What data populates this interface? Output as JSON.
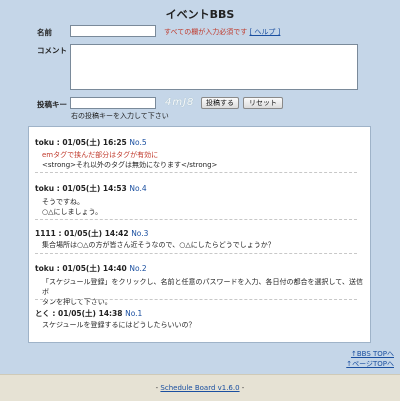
{
  "page": {
    "title": "イベントBBS"
  },
  "form": {
    "name_label": "名前",
    "comment_label": "コメント",
    "key_label": "投稿キー",
    "required_note": "すべての欄が入力必須です",
    "help_link": "[ ヘルプ ]",
    "captcha_text": "4mJ8",
    "submit_label": "投稿する",
    "reset_label": "リセット",
    "key_hint": "右の投稿キーを入力して下さい"
  },
  "posts": [
    {
      "author": "toku",
      "date": "01/05(土) 16:25",
      "no": "No.5",
      "lines": [
        "emタグで挟んだ部分はタグが有効に",
        "<strong>それ以外のタグは無効になります</strong>"
      ]
    },
    {
      "author": "toku",
      "date": "01/05(土) 14:53",
      "no": "No.4",
      "lines": [
        "そうですね。",
        "○△にしましょう。"
      ]
    },
    {
      "author": "1111",
      "date": "01/05(土) 14:42",
      "no": "No.3",
      "lines": [
        "集合場所は○△の方が皆さん近そうなので、○△にしたらどうでしょうか？"
      ]
    },
    {
      "author": "toku",
      "date": "01/05(土) 14:40",
      "no": "No.2",
      "lines": [
        "「スケジュール登録」をクリックし、名前と任意のパスワードを入力、各日付の都合を選択して、送信ボ",
        "タンを押して下さい。"
      ]
    },
    {
      "author": "とく",
      "date": "01/05(土) 14:38",
      "no": "No.1",
      "lines": [
        "スケジュールを登録するにはどうしたらいいの？"
      ]
    }
  ],
  "nav": {
    "bbs_top": "↑BBS TOPへ",
    "page_top": "↑ページTOPへ"
  },
  "footer": {
    "prefix": "- ",
    "link": "Schedule Board v1.6.0",
    "suffix": " -"
  }
}
